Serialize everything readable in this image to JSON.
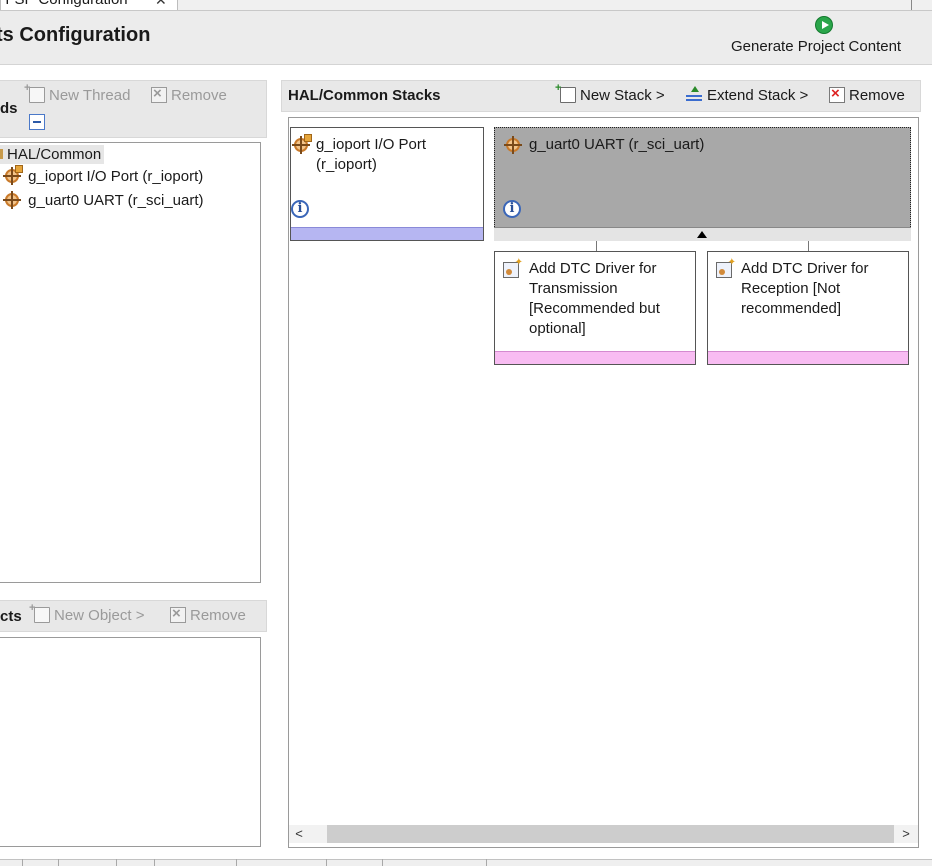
{
  "editor_tab": {
    "title": "] FSP Configuration",
    "close_glyph": "✕"
  },
  "header": {
    "title": "ts Configuration",
    "generate_label": "Generate Project Content"
  },
  "threads_panel": {
    "label": "ds",
    "new_thread_label": "New Thread",
    "remove_label": "Remove",
    "tree": {
      "root": "HAL/Common",
      "items": [
        "g_ioport I/O Port (r_ioport)",
        "g_uart0 UART (r_sci_uart)"
      ]
    }
  },
  "objects_panel": {
    "label": "cts",
    "new_object_label": "New Object >",
    "remove_label": "Remove"
  },
  "stacks_panel": {
    "label": "HAL/Common Stacks",
    "new_stack_label": "New Stack >",
    "extend_stack_label": "Extend Stack >",
    "remove_label": "Remove",
    "modules": {
      "ioport": {
        "title_line1": "g_ioport I/O Port",
        "title_line2": "(r_ioport)"
      },
      "uart": {
        "title": "g_uart0 UART (r_sci_uart)"
      },
      "dtc_tx": {
        "lines": [
          "Add DTC Driver for",
          "Transmission",
          "[Recommended but",
          "optional]"
        ]
      },
      "dtc_rx": {
        "lines": [
          "Add DTC Driver for",
          "Reception [Not",
          "recommended]"
        ]
      }
    },
    "info_glyph": "i",
    "scroll_left": "<",
    "scroll_right": ">"
  },
  "colors": {
    "selected_module_bg": "#a8a8a8",
    "lavender_bar": "#b6b6f2",
    "pink_bar": "#f8bcf2",
    "generate_icon": "#2aa54a"
  },
  "icons": {
    "generate": "play-circle-icon",
    "component": "component-gear-icon",
    "info": "info-icon",
    "add_driver": "add-driver-icon"
  }
}
